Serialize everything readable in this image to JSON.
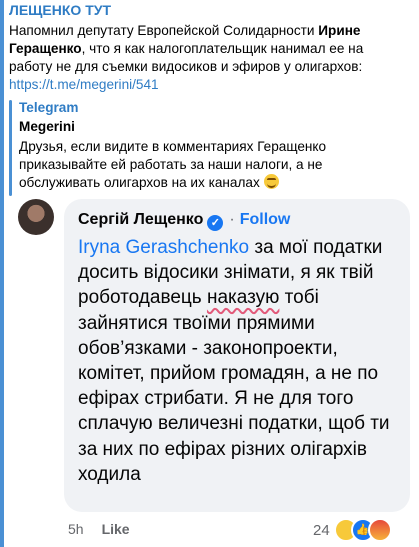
{
  "channel": {
    "name": "ЛЕЩЕНКО ТУТ"
  },
  "post": {
    "text_part1": "Напомнил депутату Европейской Солидарности ",
    "bold_name": "Ирине Геращенко",
    "text_part2": ", что я как налогоплательщик нанимал ее на работу не для съемки видосиков и эфиров у олигархов:",
    "link": "https://t.me/megerini/541"
  },
  "quote": {
    "source": "Telegram",
    "author": "Megerini",
    "text": "Друзья, если видите в комментариях Геращенко приказывайте ей работать за наши налоги, а не обслуживать олигархов на их каналах ",
    "emoji_icon": "grinning-face-icon"
  },
  "comment": {
    "author": "Сергій Лещенко",
    "verified_icon": "verified-check-icon",
    "separator": "·",
    "follow_label": "Follow",
    "mention": "Iryna Gerashchenko",
    "text_before_underline": " за мої податки досить відосики знімати, я як твій роботодавець ",
    "underlined_word": "наказую",
    "text_after_underline": " тобі зайнятися твоїми прямими обов’язками - законопроекти, комітет, прийом громадян, а не по ефірах стрибати. Я не для того сплачую величезні податки, щоб ти за них по ефірах різних олігархів ходила",
    "time": "5h",
    "like_label": "Like",
    "reaction_count": "24",
    "reaction_icons": [
      "haha-reaction-icon",
      "like-reaction-icon",
      "angry-reaction-icon"
    ]
  },
  "colors": {
    "accent": "#2f7cc4",
    "fb_blue": "#1877f2",
    "bubble_bg": "#f0f2f5",
    "underline": "#e25a7a"
  }
}
